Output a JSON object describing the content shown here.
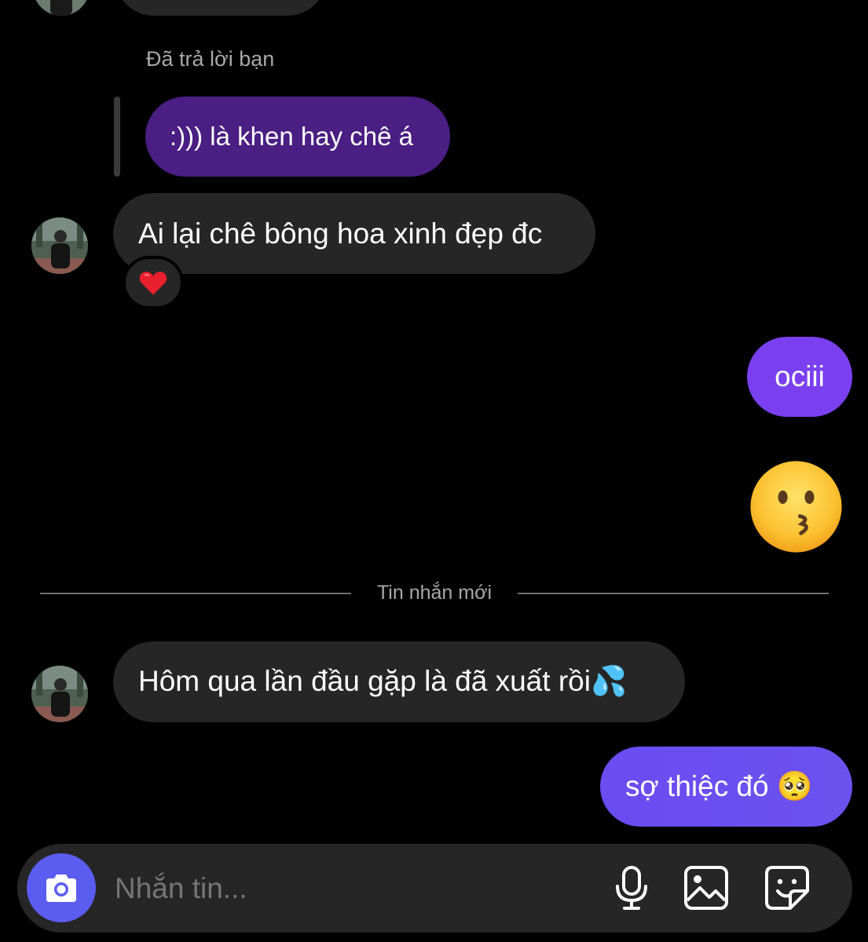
{
  "reply_context": {
    "label": "Đã trả lời bạn",
    "quoted_text": ":))) là khen hay chê á"
  },
  "messages": [
    {
      "text": "Ai lại chê bông hoa xinh đẹp đc",
      "reaction": "❤️"
    },
    {
      "text": "ociii"
    },
    {
      "emoji": "😗"
    },
    {
      "text": "Hôm qua lần đầu gặp là đã xuất rồi💦"
    },
    {
      "text": "sợ thiệc đó 🥺"
    }
  ],
  "new_messages_divider": "Tin nhắn mới",
  "composer": {
    "placeholder": "Nhắn tin...",
    "icons": [
      "camera-icon",
      "microphone-icon",
      "image-icon",
      "sticker-icon"
    ]
  },
  "colors": {
    "incoming_bubble": "#262626",
    "outgoing_purple": "#7a40ef",
    "reply_quote": "#4a1e83",
    "outgoing_gradient": "#6a4cf0",
    "camera_button": "#5b5cf0"
  }
}
